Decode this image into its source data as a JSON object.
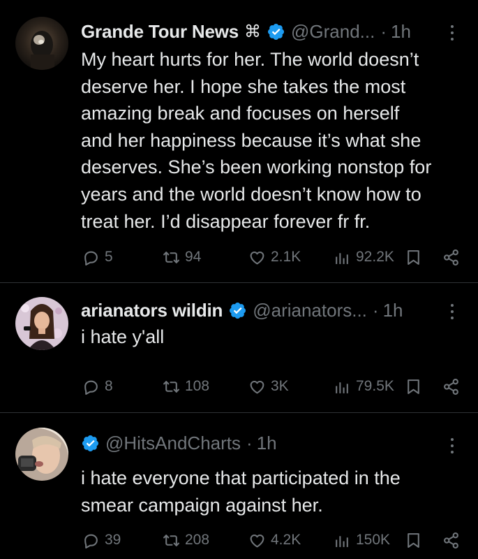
{
  "tweets": [
    {
      "display_name": "Grande Tour News",
      "name_glyph": "⌘",
      "handle": "@Grand...",
      "dot": "·",
      "time": "1h",
      "text_lines": [
        "My heart hurts for her. The world doesn’t",
        "deserve her. I hope she takes the most",
        "amazing break and focuses on herself",
        "and her happiness because it’s what she",
        "deserves. She’s been working nonstop for",
        "years and the world doesn’t know how to",
        "treat her. I’d disappear forever fr fr."
      ],
      "replies": "5",
      "reposts": "94",
      "likes": "2.1K",
      "views": "92.2K"
    },
    {
      "display_name": "arianators wildin",
      "handle": "@arianators...",
      "dot": "·",
      "time": "1h",
      "text_lines": [
        "i hate y'all"
      ],
      "replies": "8",
      "reposts": "108",
      "likes": "3K",
      "views": "79.5K"
    },
    {
      "display_name": "",
      "handle": "@HitsAndCharts",
      "dot": "·",
      "time": "1h",
      "text_lines": [
        "i hate everyone that participated in the",
        "smear campaign against her."
      ],
      "replies": "39",
      "reposts": "208",
      "likes": "4.2K",
      "views": "150K"
    }
  ],
  "colors": {
    "background": "#000000",
    "text": "#e7e9ea",
    "secondary": "#71767b",
    "verified": "#1d9bf0",
    "divider": "#2f3336"
  },
  "icons": {
    "reply": "reply-icon",
    "repost": "repost-icon",
    "like": "like-icon",
    "views": "views-icon",
    "bookmark": "bookmark-icon",
    "share": "share-icon",
    "more": "more-icon",
    "verified": "verified-badge-icon"
  }
}
